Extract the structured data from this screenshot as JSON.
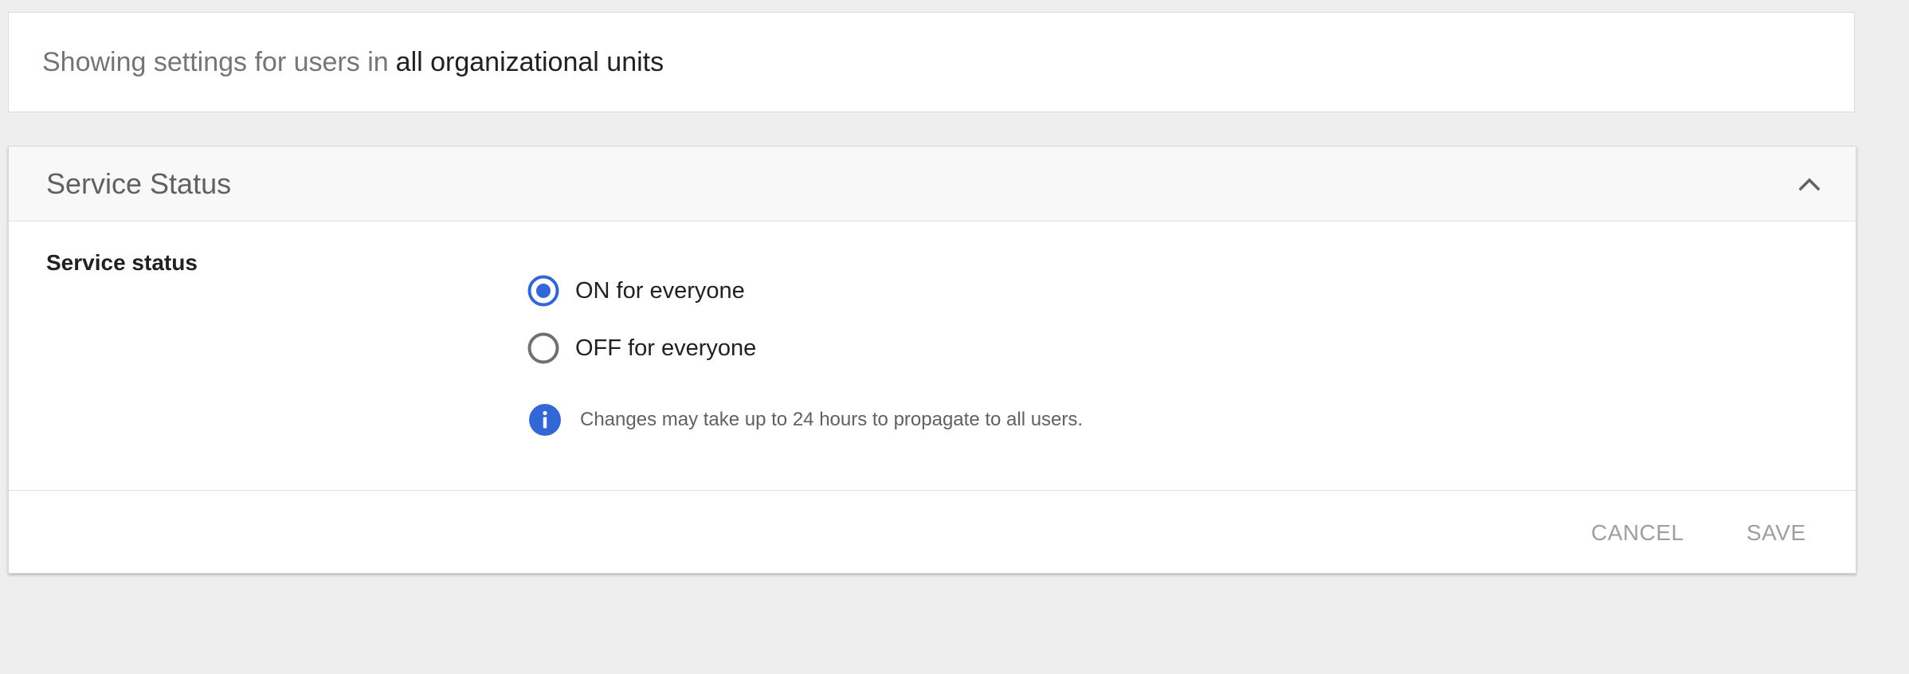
{
  "ou_banner": {
    "prefix": "Showing settings for users in",
    "org_unit": "all organizational units"
  },
  "section": {
    "title": "Service Status",
    "collapse_icon": "chevron-up-icon",
    "setting_label": "Service status",
    "options": [
      {
        "label": "ON for everyone",
        "selected": true
      },
      {
        "label": "OFF for everyone",
        "selected": false
      }
    ],
    "info_icon": "info-icon",
    "info_text": "Changes may take up to 24 hours to propagate to all users."
  },
  "footer": {
    "cancel_label": "CANCEL",
    "save_label": "SAVE"
  },
  "colors": {
    "accent": "#3367d6",
    "page_bg": "#eeeeee",
    "disabled_text": "#9e9e9e"
  }
}
